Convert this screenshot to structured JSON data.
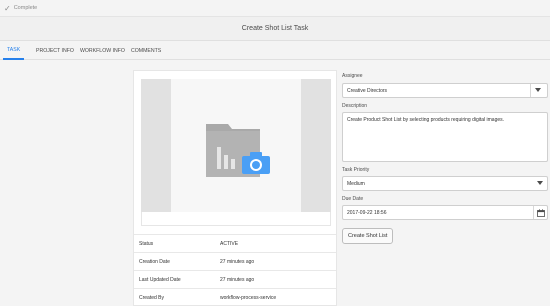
{
  "topbar": {
    "complete_label": "Complete"
  },
  "header": {
    "title": "Create Shot List Task"
  },
  "tabs": [
    {
      "label": "TASK"
    },
    {
      "label": "PROJECT INFO"
    },
    {
      "label": "WORKFLOW INFO"
    },
    {
      "label": "COMMENTS"
    }
  ],
  "details": [
    {
      "key": "Status",
      "value": "ACTIVE"
    },
    {
      "key": "Creation Date",
      "value": "27 minutes ago"
    },
    {
      "key": "Last Updated Date",
      "value": "27 minutes ago"
    },
    {
      "key": "Created By",
      "value": "workflow-process-service"
    }
  ],
  "form": {
    "assignee_label": "Assignee",
    "assignee_value": "Creative Directors",
    "description_label": "Description",
    "description_value": "Create Product Shot List by selecting products requiring digital images.",
    "priority_label": "Task Priority",
    "priority_value": "Medium",
    "due_label": "Due Date",
    "due_value": "2017-09-22 18:56",
    "submit_label": "Create Shot List"
  },
  "colors": {
    "accent": "#2680eb",
    "camera": "#4a9ff5"
  }
}
